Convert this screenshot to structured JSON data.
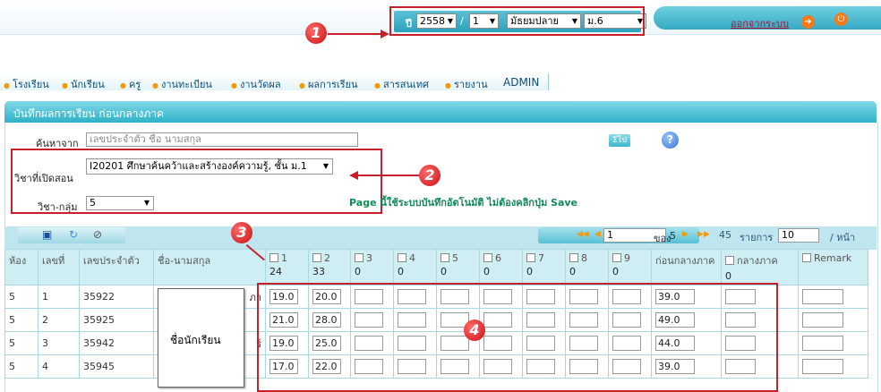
{
  "filter_bar": {
    "year_prefix": "ปี",
    "year": "2558",
    "semester": "1",
    "level": "มัธยมปลาย",
    "grade": "ม.6"
  },
  "header": {
    "logout_label": "ออกจากระบบ"
  },
  "menu": [
    "โรงเรียน",
    "นักเรียน",
    "ครู",
    "งานทะเบียน",
    "งานวัดผล",
    "ผลการเรียน",
    "สารสนเทศ",
    "รายงาน",
    "ADMIN"
  ],
  "panel": {
    "title": "บันทึกผลการเรียน ก่อนกลางภาค"
  },
  "search": {
    "label": "ค้นหาจาก",
    "placeholder": "เลขประจำตัว ชื่อ นามสกุล",
    "go_label": "ไป"
  },
  "subject": {
    "label": "วิชาที่เปิดสอน",
    "value": "I20201 ศึกษาค้นคว้าและสร้างองค์ความรู้, ชั้น ม.1"
  },
  "group": {
    "label": "วิชา-กลุ่ม",
    "value": "5"
  },
  "note": "Page นี้ใช้ระบบบันทึกอัตโนมัติ ไม่ต้องคลิกปุ่ม Save",
  "pager": {
    "page": "1",
    "of_label": "ของ",
    "total_pages": "5",
    "total_records": "45",
    "records_label": "รายการ",
    "per_page": "10",
    "per_page_label": "/ หน้า"
  },
  "columns": {
    "room": "ห้อง",
    "no": "เลขที่",
    "student_id": "เลขประจำตัว",
    "name": "ชื่อ-นามสกุล",
    "scores": [
      {
        "label": "1",
        "max": "24"
      },
      {
        "label": "2",
        "max": "33"
      },
      {
        "label": "3",
        "max": "0"
      },
      {
        "label": "4",
        "max": "0"
      },
      {
        "label": "5",
        "max": "0"
      },
      {
        "label": "6",
        "max": "0"
      },
      {
        "label": "7",
        "max": "0"
      },
      {
        "label": "8",
        "max": "0"
      },
      {
        "label": "9",
        "max": "0"
      }
    ],
    "before_midterm": "ก่อนกลางภาค",
    "midterm": "กลางภาค",
    "midterm_max": "0",
    "remark": "Remark"
  },
  "rows": [
    {
      "room": "5",
      "no": "1",
      "id": "35922",
      "name_tail": "ภา",
      "s1": "19.0",
      "s2": "20.0",
      "total": "39.0"
    },
    {
      "room": "5",
      "no": "2",
      "id": "35925",
      "name_tail": "",
      "s1": "21.0",
      "s2": "28.0",
      "total": "49.0"
    },
    {
      "room": "5",
      "no": "3",
      "id": "35942",
      "name_tail": "ร์",
      "s1": "19.0",
      "s2": "25.0",
      "total": "44.0"
    },
    {
      "room": "5",
      "no": "4",
      "id": "35945",
      "name_tail": "",
      "s1": "17.0",
      "s2": "22.0",
      "total": "39.0"
    }
  ],
  "tooltip": "ชื่อนักเรียน",
  "callouts": [
    "1",
    "2",
    "3",
    "4"
  ],
  "colors": {
    "accent": "#2fb0c8",
    "callout_red": "#c8202a",
    "note_green": "#108a5a"
  }
}
